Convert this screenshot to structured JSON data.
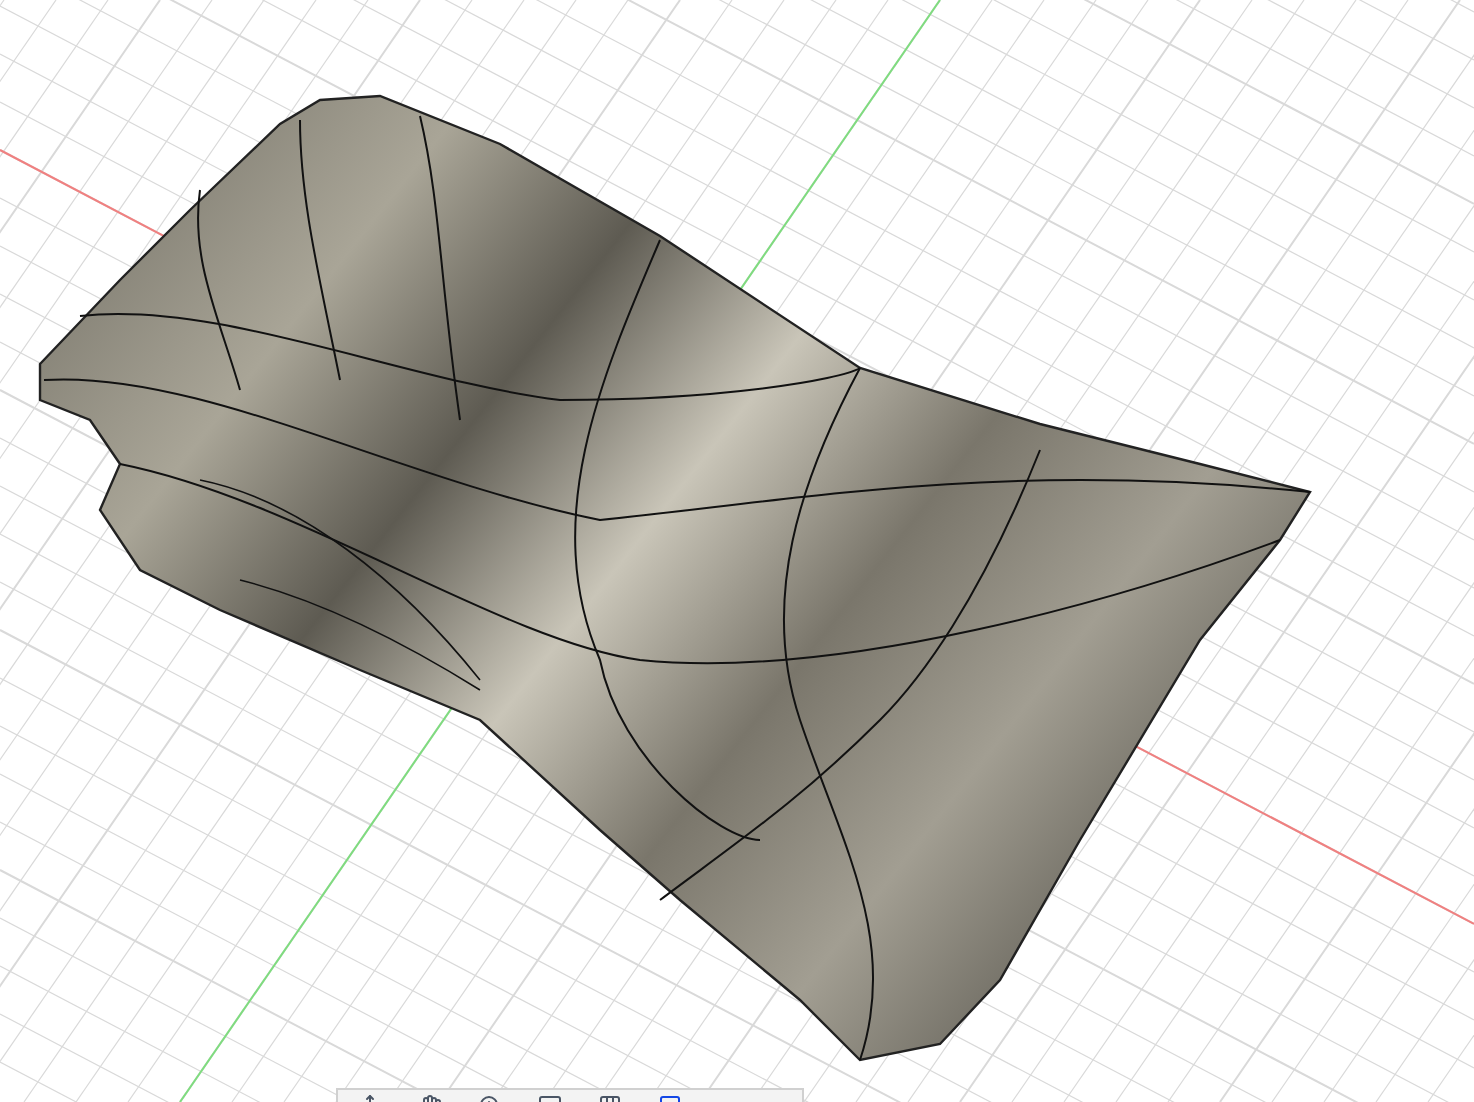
{
  "axes": [
    {
      "kind": "x",
      "color": "#f08080"
    },
    {
      "kind": "y",
      "color": "#7fdc7f"
    }
  ]
}
